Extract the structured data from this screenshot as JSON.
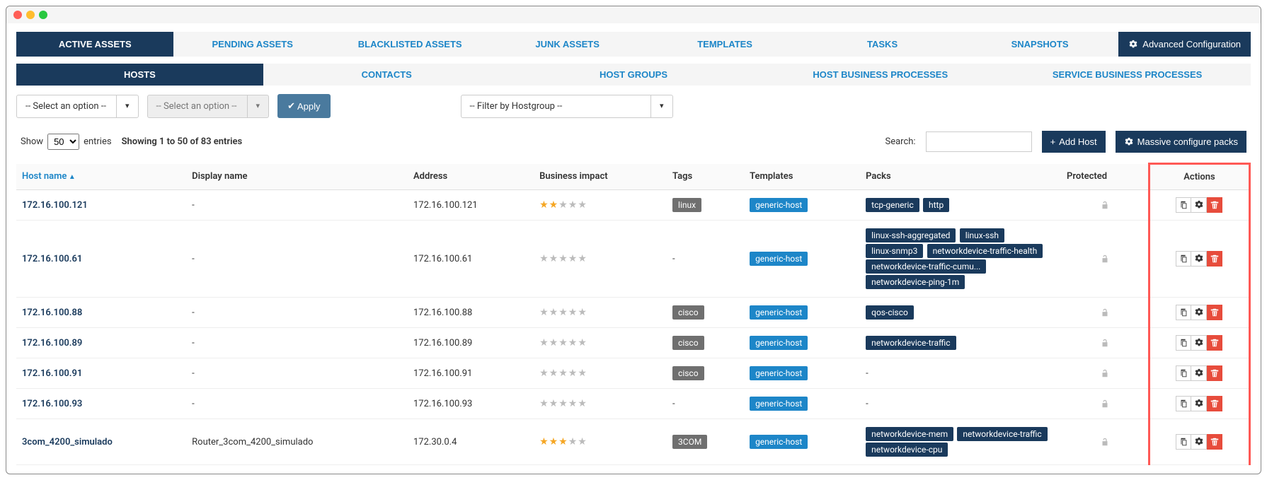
{
  "tabs1": [
    {
      "label": "ACTIVE ASSETS",
      "active": true
    },
    {
      "label": "PENDING ASSETS",
      "active": false
    },
    {
      "label": "BLACKLISTED ASSETS",
      "active": false
    },
    {
      "label": "JUNK ASSETS",
      "active": false
    },
    {
      "label": "TEMPLATES",
      "active": false
    },
    {
      "label": "TASKS",
      "active": false
    },
    {
      "label": "SNAPSHOTS",
      "active": false
    }
  ],
  "adv_config_label": "Advanced Configuration",
  "tabs2": [
    {
      "label": "HOSTS",
      "active": true
    },
    {
      "label": "CONTACTS",
      "active": false
    },
    {
      "label": "HOST GROUPS",
      "active": false
    },
    {
      "label": "HOST BUSINESS PROCESSES",
      "active": false
    },
    {
      "label": "SERVICE BUSINESS PROCESSES",
      "active": false
    }
  ],
  "filters": {
    "select1_placeholder": "-- Select an option --",
    "select2_placeholder": "-- Select an option --",
    "apply_label": "Apply",
    "hostgroup_placeholder": "-- Filter by Hostgroup --"
  },
  "entries": {
    "show_label": "Show",
    "count": "50",
    "entries_label": "entries",
    "info": "Showing 1 to 50 of 83 entries",
    "search_label": "Search:",
    "add_host_label": "Add Host",
    "massive_label": "Massive configure packs"
  },
  "columns": [
    "Host name",
    "Display name",
    "Address",
    "Business impact",
    "Tags",
    "Templates",
    "Packs",
    "Protected",
    "Actions"
  ],
  "rows": [
    {
      "host": "172.16.100.121",
      "display": "-",
      "address": "172.16.100.121",
      "impact": 2,
      "tags": [
        "linux"
      ],
      "templates": [
        "generic-host"
      ],
      "packs": [
        "tcp-generic",
        "http"
      ],
      "protected": false
    },
    {
      "host": "172.16.100.61",
      "display": "-",
      "address": "172.16.100.61",
      "impact": 0,
      "tags": [],
      "templates": [
        "generic-host"
      ],
      "packs": [
        "linux-ssh-aggregated",
        "linux-ssh",
        "linux-snmp3",
        "networkdevice-traffic-health",
        "networkdevice-traffic-cumu...",
        "networkdevice-ping-1m"
      ],
      "protected": false
    },
    {
      "host": "172.16.100.88",
      "display": "-",
      "address": "172.16.100.88",
      "impact": 0,
      "tags": [
        "cisco"
      ],
      "templates": [
        "generic-host"
      ],
      "packs": [
        "qos-cisco"
      ],
      "protected": false
    },
    {
      "host": "172.16.100.89",
      "display": "-",
      "address": "172.16.100.89",
      "impact": 0,
      "tags": [
        "cisco"
      ],
      "templates": [
        "generic-host"
      ],
      "packs": [
        "networkdevice-traffic"
      ],
      "protected": false
    },
    {
      "host": "172.16.100.91",
      "display": "-",
      "address": "172.16.100.91",
      "impact": 0,
      "tags": [
        "cisco"
      ],
      "templates": [
        "generic-host"
      ],
      "packs": [],
      "protected": false
    },
    {
      "host": "172.16.100.93",
      "display": "-",
      "address": "172.16.100.93",
      "impact": 0,
      "tags": [],
      "templates": [
        "generic-host"
      ],
      "packs": [],
      "protected": false
    },
    {
      "host": "3com_4200_simulado",
      "display": "Router_3com_4200_simulado",
      "address": "172.30.0.4",
      "impact": 3,
      "tags": [
        "3COM"
      ],
      "templates": [
        "generic-host"
      ],
      "packs": [
        "networkdevice-mem",
        "networkdevice-traffic",
        "networkdevice-cpu"
      ],
      "protected": false
    }
  ]
}
